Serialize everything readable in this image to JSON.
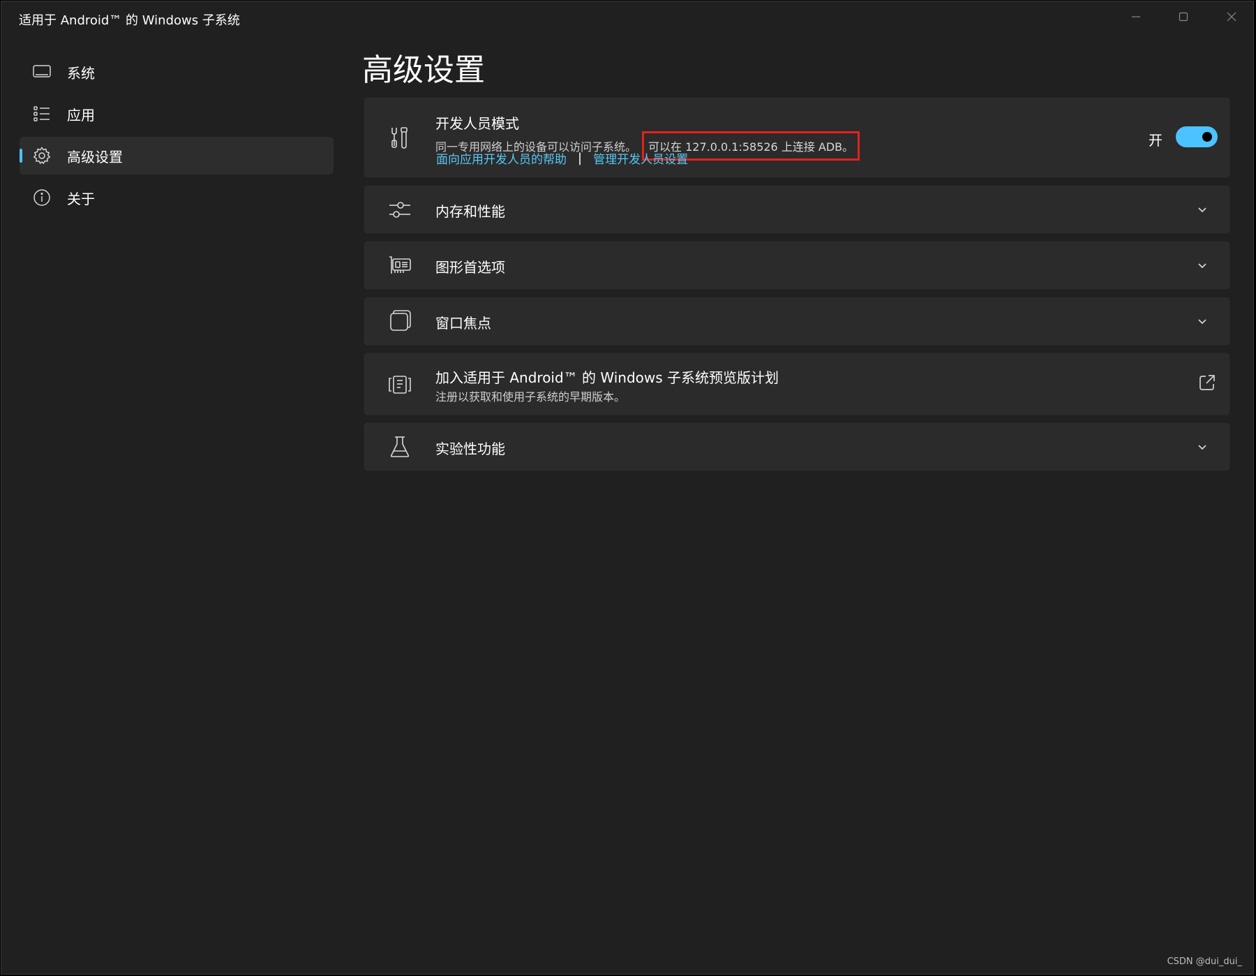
{
  "window": {
    "title": "适用于 Android™ 的 Windows 子系统",
    "controls": [
      "minimize-icon",
      "maximize-icon",
      "close-icon"
    ]
  },
  "sidebar": {
    "items": [
      {
        "label": "系统",
        "icon": "monitor-icon",
        "active": false
      },
      {
        "label": "应用",
        "icon": "list-icon",
        "active": false
      },
      {
        "label": "高级设置",
        "icon": "gear-icon",
        "active": true
      },
      {
        "label": "关于",
        "icon": "info-icon",
        "active": false
      }
    ]
  },
  "main": {
    "title": "高级设置",
    "developer_mode": {
      "title": "开发人员模式",
      "description": "同一专用网络上的设备可以访问子系统。",
      "adb_text": "可以在 127.0.0.1:58526 上连接 ADB。",
      "link_help": "面向应用开发人员的帮助",
      "link_separator": "|",
      "link_manage": "管理开发人员设置",
      "toggle_label": "开",
      "toggle_on": true,
      "icon": "tools-icon"
    },
    "memory": {
      "title": "内存和性能",
      "icon": "sliders-icon"
    },
    "graphics": {
      "title": "图形首选项",
      "icon": "graphics-card-icon"
    },
    "window_focus": {
      "title": "窗口焦点",
      "icon": "window-focus-icon"
    },
    "preview_program": {
      "title": "加入适用于 Android™ 的 Windows 子系统预览版计划",
      "subtitle": "注册以获取和使用子系统的早期版本。",
      "icon": "preview-icon"
    },
    "experimental": {
      "title": "实验性功能",
      "icon": "flask-icon"
    }
  },
  "watermark": "CSDN @dui_dui_",
  "colors": {
    "background": "#202020",
    "card": "#2b2b2b",
    "accent": "#4cc2ff",
    "link": "#58c7f5",
    "highlight_box": "#e3221d"
  }
}
